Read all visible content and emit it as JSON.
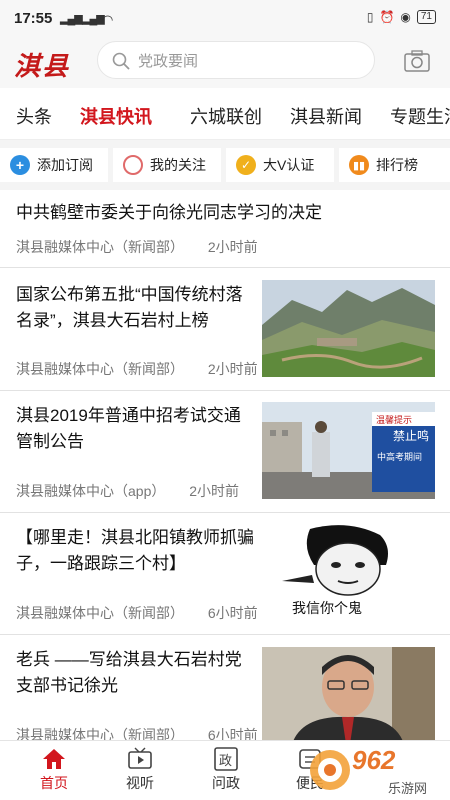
{
  "status": {
    "time": "17:55",
    "signal1": "⁴⁶ᴵ",
    "signal2": "⁴⁶ᴵ",
    "battery": "71"
  },
  "header": {
    "logo": "淇县",
    "search_placeholder": "党政要闻"
  },
  "tabs": [
    "头条",
    "淇县快讯",
    "六城联创",
    "淇县新闻",
    "专题生活"
  ],
  "active_tab": "淇县快讯",
  "quick": [
    {
      "label": "添加订阅",
      "icon": "plus-icon",
      "color": "#2b8ee0"
    },
    {
      "label": "我的关注",
      "icon": "circle-icon",
      "color": "#e06a6a"
    },
    {
      "label": "大V认证",
      "icon": "check-icon",
      "color": "#f0b01c"
    },
    {
      "label": "排行榜",
      "icon": "chart-icon",
      "color": "#f08a1c"
    }
  ],
  "feed": [
    {
      "title": "中共鹤壁市委关于向徐光同志学习的决定",
      "source": "淇县融媒体中心（新闻部）",
      "time": "2小时前"
    },
    {
      "title": "国家公布第五批“中国传统村落名录”，淇县大石岩村上榜",
      "source": "淇县融媒体中心（新闻部）",
      "time": "2小时前"
    },
    {
      "title": " 淇县2019年普通中招考试交通管制公告",
      "source": "淇县融媒体中心（app）",
      "time": "2小时前"
    },
    {
      "title": "【哪里走！淇县北阳镇教师抓骗子，一路跟踪三个村】",
      "source": "淇县融媒体中心（新闻部）",
      "time": "6小时前"
    },
    {
      "title": "老兵 ——写给淇县大石岩村党支部书记徐光",
      "source": "淇县融媒体中心（新闻部）",
      "time": "6小时前"
    }
  ],
  "meme_caption": "我信你个鬼",
  "sign_texts": [
    "禁止鸣",
    "中高考期间",
    "温馨提示"
  ],
  "nav": [
    {
      "label": "首页",
      "icon": "home-icon"
    },
    {
      "label": "视听",
      "icon": "tv-icon"
    },
    {
      "label": "问政",
      "icon": "politics-icon"
    },
    {
      "label": "便民",
      "icon": "service-icon"
    }
  ],
  "watermark": {
    "text": "962",
    "sub": "乐游网"
  },
  "colors": {
    "accent": "#d2161d",
    "header_bg": "#f7f7f7"
  }
}
